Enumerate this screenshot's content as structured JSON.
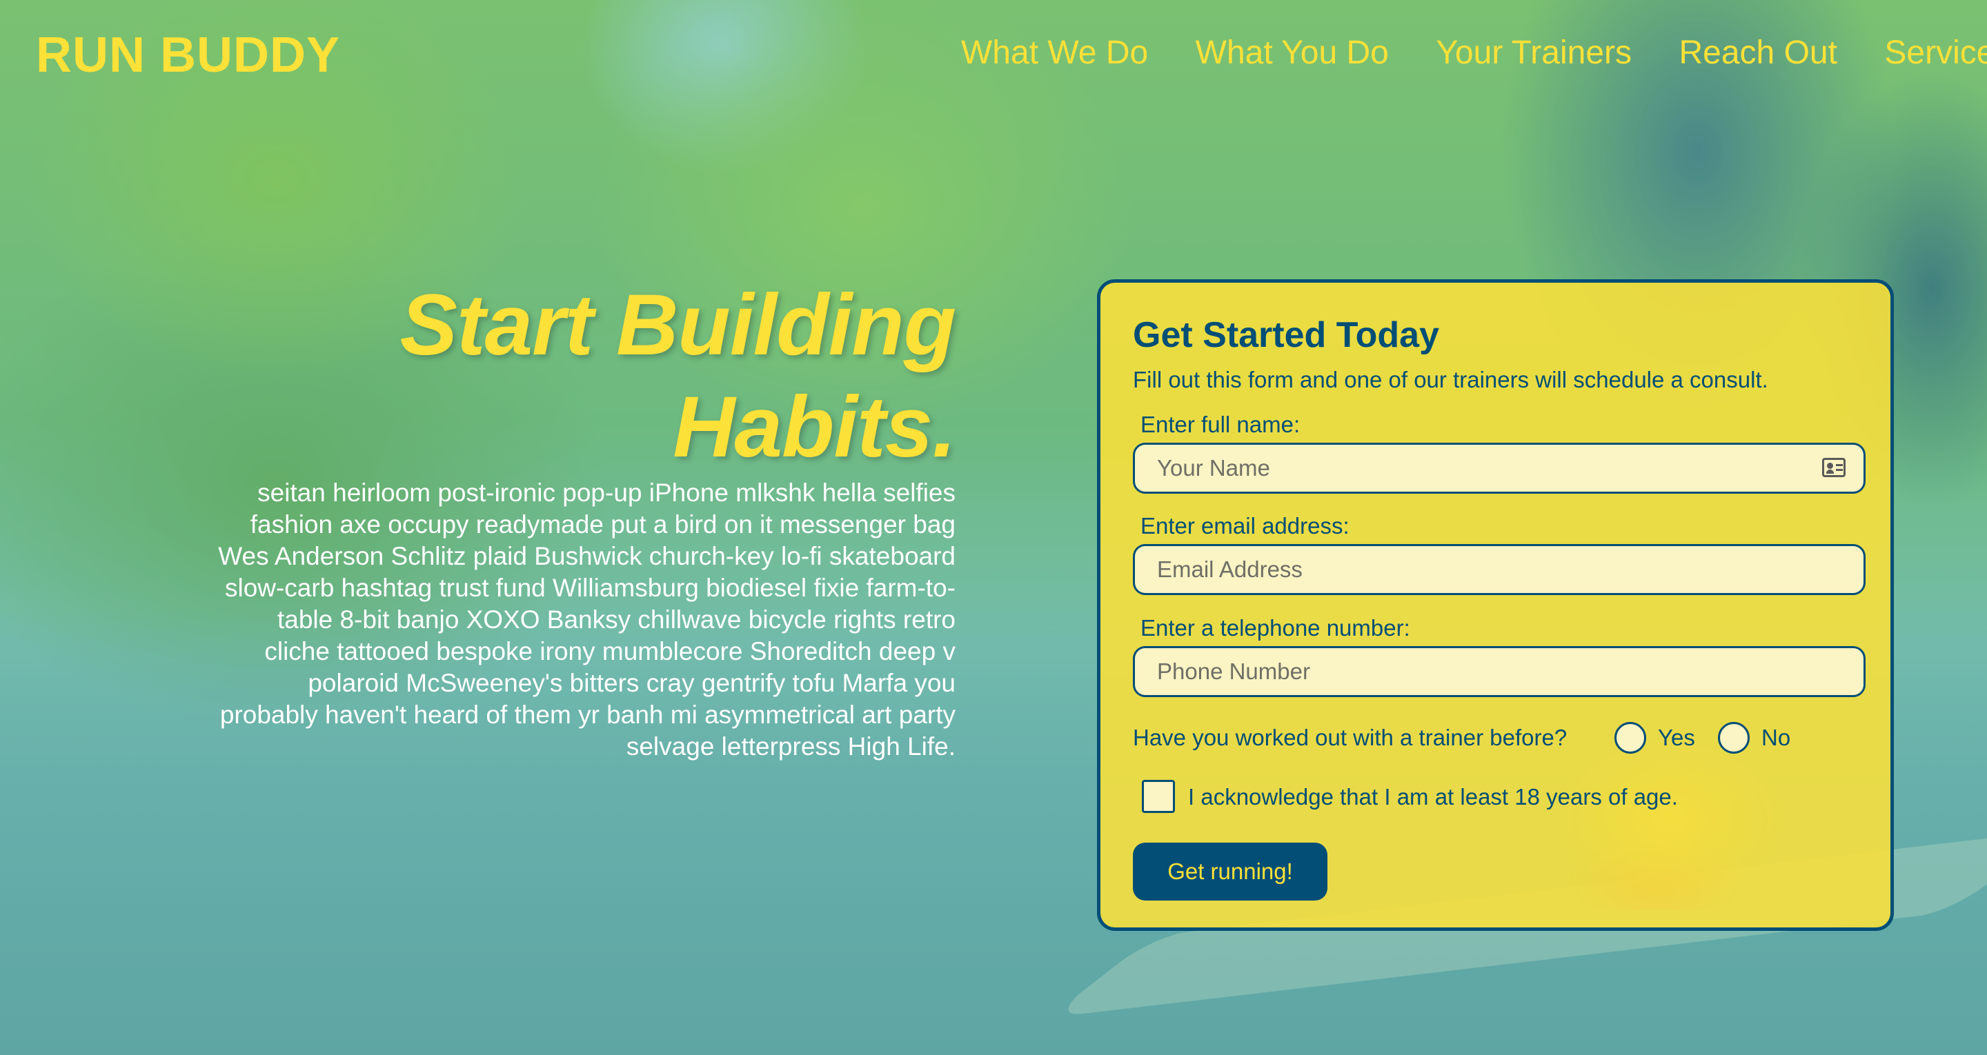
{
  "header": {
    "logo": "RUN BUDDY",
    "nav": [
      "What We Do",
      "What You Do",
      "Your Trainers",
      "Reach Out",
      "Services"
    ]
  },
  "hero": {
    "title": "Start Building Habits.",
    "text": "seitan heirloom post-ironic pop-up iPhone mlkshk hella selfies fashion axe occupy readymade put a bird on it messenger bag Wes Anderson Schlitz plaid Bushwick church-key lo-fi skateboard slow-carb hashtag trust fund Williamsburg biodiesel fixie farm-to-table 8-bit banjo XOXO Banksy chillwave bicycle rights retro cliche tattooed bespoke irony mumblecore Shoreditch deep v polaroid McSweeney's bitters cray gentrify tofu Marfa you probably haven't heard of them yr banh mi asymmetrical art party selvage letterpress High Life."
  },
  "form": {
    "title": "Get Started Today",
    "subtitle": "Fill out this form and one of our trainers will schedule a consult.",
    "name_label": "Enter full name:",
    "name_placeholder": "Your Name",
    "name_value": "",
    "email_label": "Enter email address:",
    "email_placeholder": "Email Address",
    "email_value": "",
    "phone_label": "Enter a telephone number:",
    "phone_placeholder": "Phone Number",
    "phone_value": "",
    "trainer_question": "Have you worked out with a trainer before?",
    "yes_label": "Yes",
    "no_label": "No",
    "age_ack": "I acknowledge that I am at least 18 years of age.",
    "submit_label": "Get running!"
  },
  "colors": {
    "accent_yellow": "#fce138",
    "navy": "#024e76",
    "input_bg": "#fbf4c4"
  },
  "icons": {
    "name_field_icon": "contact-card-icon"
  }
}
